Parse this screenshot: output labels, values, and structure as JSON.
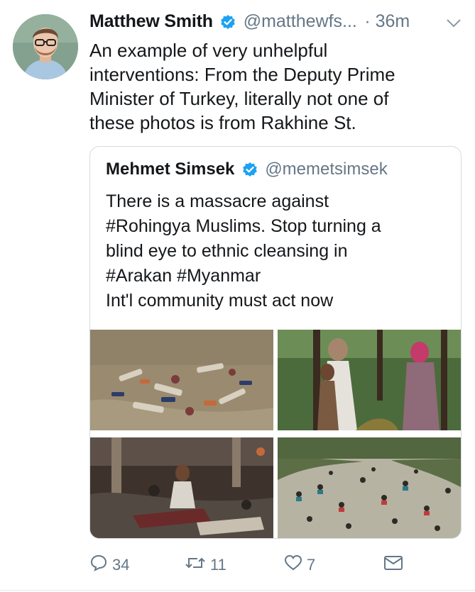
{
  "tweet": {
    "author_name": "Matthew Smith",
    "author_handle": "@matthewfs...",
    "time": "· 36m",
    "text": "An example of very unhelpful\ninterventions: From the Deputy Prime\nMinister of Turkey, literally not one of\nthese photos is from Rakhine St."
  },
  "quoted": {
    "author_name": "Mehmet Simsek",
    "author_handle": "@memetsimsek",
    "text": "There is a massacre against\n#Rohingya Muslims. Stop turning a\nblind eye to ethnic cleansing in\n#Arakan #Myanmar\nInt'l community must act now"
  },
  "actions": {
    "replies": "34",
    "retweets": "11",
    "likes": "7"
  },
  "colors": {
    "verified": "#1da1f2",
    "muted": "#657786",
    "border": "#d3dbe2"
  },
  "icons": [
    "avatar",
    "verified-badge-icon",
    "chevron-down-icon",
    "reply-icon",
    "retweet-icon",
    "like-icon",
    "direct-message-icon"
  ]
}
